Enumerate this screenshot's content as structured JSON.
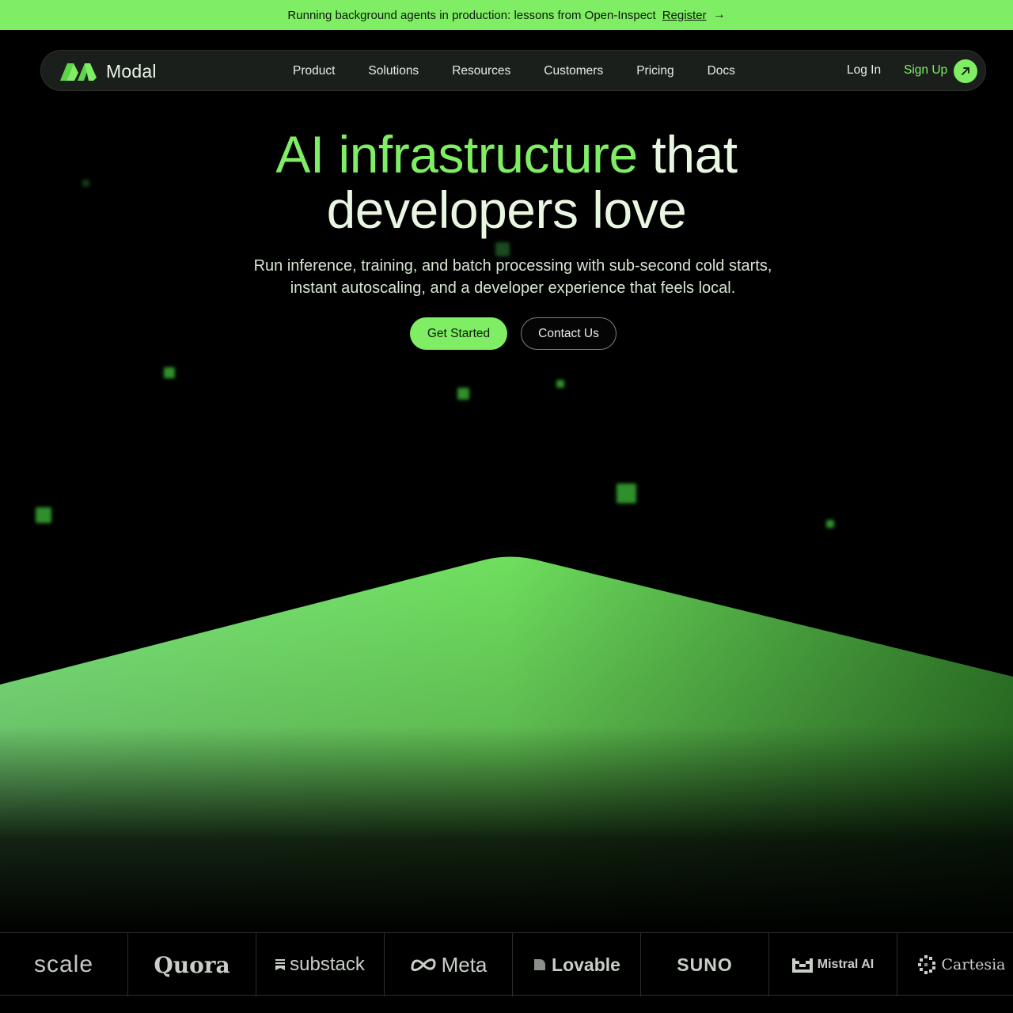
{
  "announcement": {
    "text": "Running background agents in production: lessons from Open-Inspect",
    "link_label": "Register"
  },
  "nav": {
    "brand": "Modal",
    "links": [
      "Product",
      "Solutions",
      "Resources",
      "Customers",
      "Pricing",
      "Docs"
    ],
    "login_label": "Log In",
    "signup_label": "Sign Up"
  },
  "hero": {
    "title_accent": "AI infrastructure",
    "title_rest_1": "that",
    "title_rest_2": "developers love",
    "subtitle": "Run inference, training, and batch processing with sub-second cold starts, instant autoscaling, and a developer experience that feels local.",
    "primary_cta": "Get Started",
    "secondary_cta": "Contact Us"
  },
  "customers": [
    "scale",
    "Quora",
    "substack",
    "Meta",
    "Lovable",
    "SUNO",
    "Mistral AI",
    "Cartesia"
  ],
  "colors": {
    "accent": "#7fee64",
    "background": "#000000",
    "nav_bg": "#1b1f1c"
  }
}
